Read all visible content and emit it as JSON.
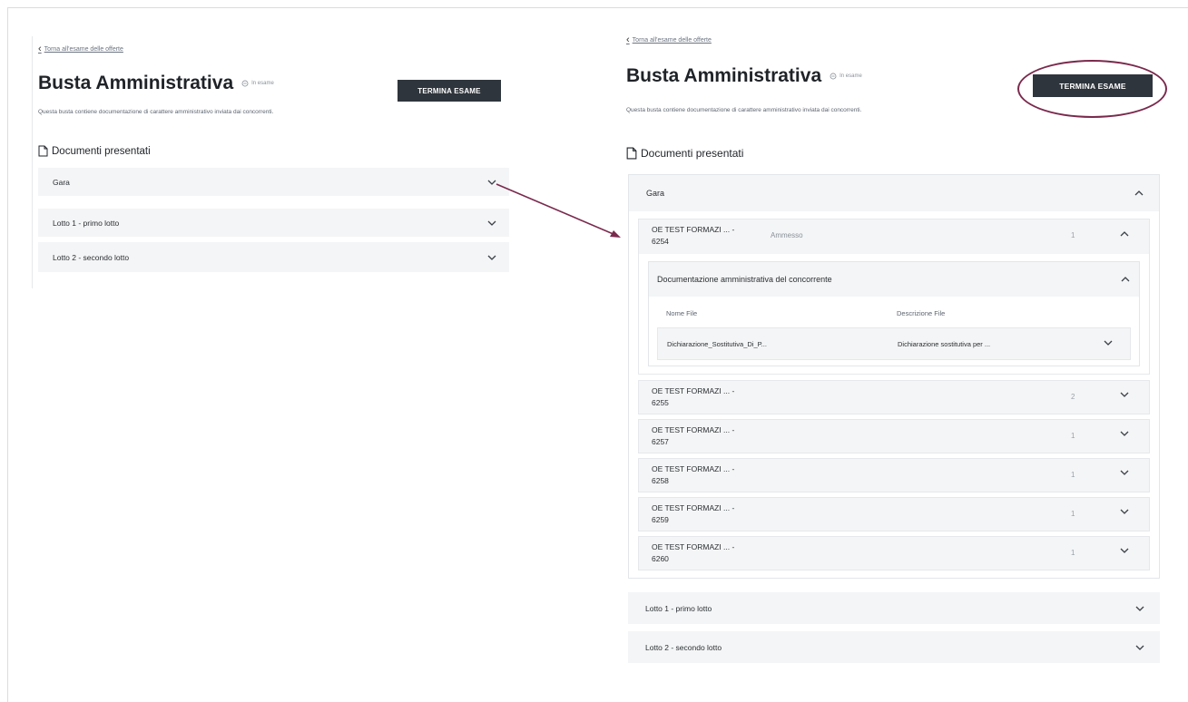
{
  "back_link": "Torna all'esame delle offerte",
  "page_title": "Busta Amministrativa",
  "status_label": "In esame",
  "terminate_button": "TERMINA ESAME",
  "description": "Questa busta contiene documentazione di carattere amministrativo inviata dai concorrenti.",
  "section_title": "Documenti presentati",
  "accordions_collapsed": [
    {
      "label": "Gara"
    },
    {
      "label": "Lotto 1 - primo lotto"
    },
    {
      "label": "Lotto 2 - secondo lotto"
    }
  ],
  "gara": {
    "label": "Gara",
    "operators": [
      {
        "name_line1": "OE TEST FORMAZI ... -",
        "name_line2": "6254",
        "status": "Ammesso",
        "count": "1",
        "expanded": true
      },
      {
        "name_line1": "OE TEST FORMAZI ... -",
        "name_line2": "6255",
        "status": "",
        "count": "2",
        "expanded": false
      },
      {
        "name_line1": "OE TEST FORMAZI ... -",
        "name_line2": "6257",
        "status": "",
        "count": "1",
        "expanded": false
      },
      {
        "name_line1": "OE TEST FORMAZI ... -",
        "name_line2": "6258",
        "status": "",
        "count": "1",
        "expanded": false
      },
      {
        "name_line1": "OE TEST FORMAZI ... -",
        "name_line2": "6259",
        "status": "",
        "count": "1",
        "expanded": false
      },
      {
        "name_line1": "OE TEST FORMAZI ... -",
        "name_line2": "6260",
        "status": "",
        "count": "1",
        "expanded": false
      }
    ],
    "doc_section": {
      "title": "Documentazione amministrativa del concorrente",
      "col_file_name": "Nome File",
      "col_file_desc": "Descrizione File",
      "files": [
        {
          "name": "Dichiarazione_Sostitutiva_Di_P...",
          "description": "Dichiarazione sostitutiva per ..."
        }
      ]
    }
  },
  "lotti": [
    {
      "label": "Lotto 1 - primo lotto"
    },
    {
      "label": "Lotto 2 - secondo lotto"
    }
  ],
  "colors": {
    "primary_button": "#2f353c",
    "annotation": "#7a2a4d",
    "accordion_bg": "#f4f5f6"
  }
}
